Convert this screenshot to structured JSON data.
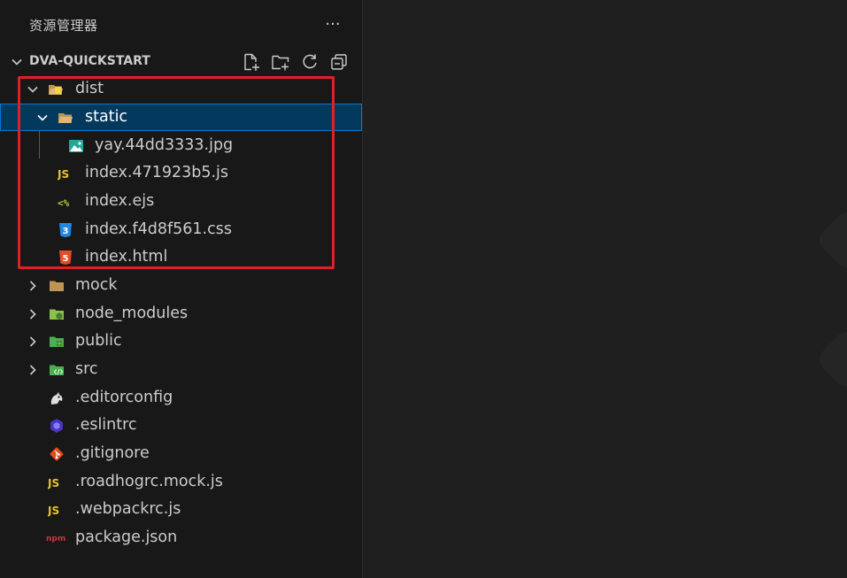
{
  "panel": {
    "title": "资源管理器",
    "more": "···"
  },
  "section": {
    "title": "DVA-QUICKSTART"
  },
  "tree": [
    {
      "label": "dist",
      "kind": "folder",
      "expanded": true,
      "icon": "folder-dist-open-icon"
    },
    {
      "label": "static",
      "kind": "folder",
      "expanded": true,
      "icon": "folder-open-icon",
      "selected": true
    },
    {
      "label": "yay.44dd3333.jpg",
      "kind": "file",
      "icon": "image-file-icon"
    },
    {
      "label": "index.471923b5.js",
      "kind": "file",
      "icon": "javascript-file-icon"
    },
    {
      "label": "index.ejs",
      "kind": "file",
      "icon": "ejs-file-icon"
    },
    {
      "label": "index.f4d8f561.css",
      "kind": "file",
      "icon": "css-file-icon"
    },
    {
      "label": "index.html",
      "kind": "file",
      "icon": "html-file-icon"
    },
    {
      "label": "mock",
      "kind": "folder",
      "expanded": false,
      "icon": "folder-icon"
    },
    {
      "label": "node_modules",
      "kind": "folder",
      "expanded": false,
      "icon": "folder-node-icon"
    },
    {
      "label": "public",
      "kind": "folder",
      "expanded": false,
      "icon": "folder-public-icon"
    },
    {
      "label": "src",
      "kind": "folder",
      "expanded": false,
      "icon": "folder-src-icon"
    },
    {
      "label": ".editorconfig",
      "kind": "file",
      "icon": "editorconfig-file-icon"
    },
    {
      "label": ".eslintrc",
      "kind": "file",
      "icon": "eslint-file-icon"
    },
    {
      "label": ".gitignore",
      "kind": "file",
      "icon": "git-file-icon"
    },
    {
      "label": ".roadhogrc.mock.js",
      "kind": "file",
      "icon": "javascript-file-icon"
    },
    {
      "label": ".webpackrc.js",
      "kind": "file",
      "icon": "javascript-file-icon"
    },
    {
      "label": "package.json",
      "kind": "file",
      "icon": "npm-file-icon"
    }
  ],
  "icon_text": {
    "js": "JS",
    "npm": "npm",
    "ejs": "<%",
    "css3": "3",
    "html5": "5"
  },
  "colors": {
    "selection": "#04395e",
    "selection_border": "#0078d4",
    "highlight_box": "#e02027",
    "folder": "#c09553",
    "js": "#e8c22a"
  }
}
